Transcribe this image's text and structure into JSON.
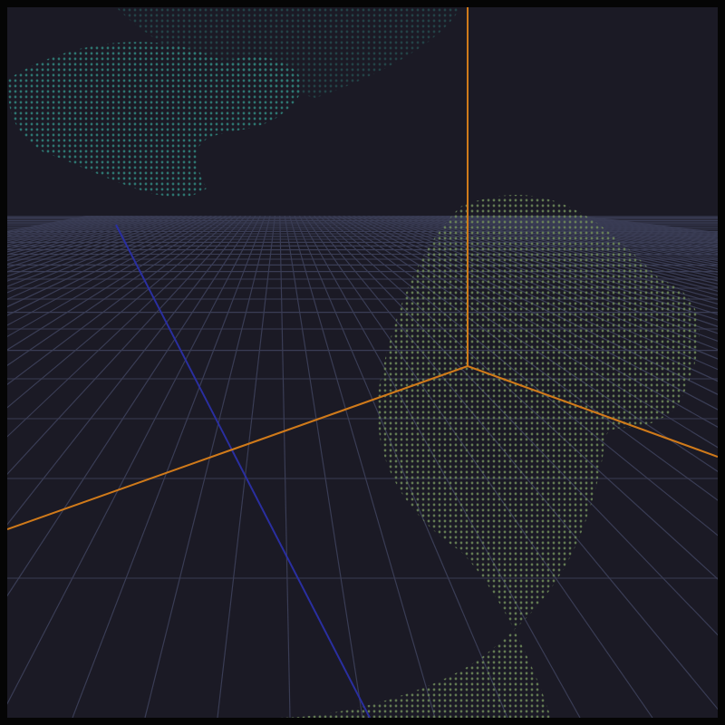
{
  "viewport": {
    "grid": true,
    "axes": true,
    "point_cloud": true
  }
}
